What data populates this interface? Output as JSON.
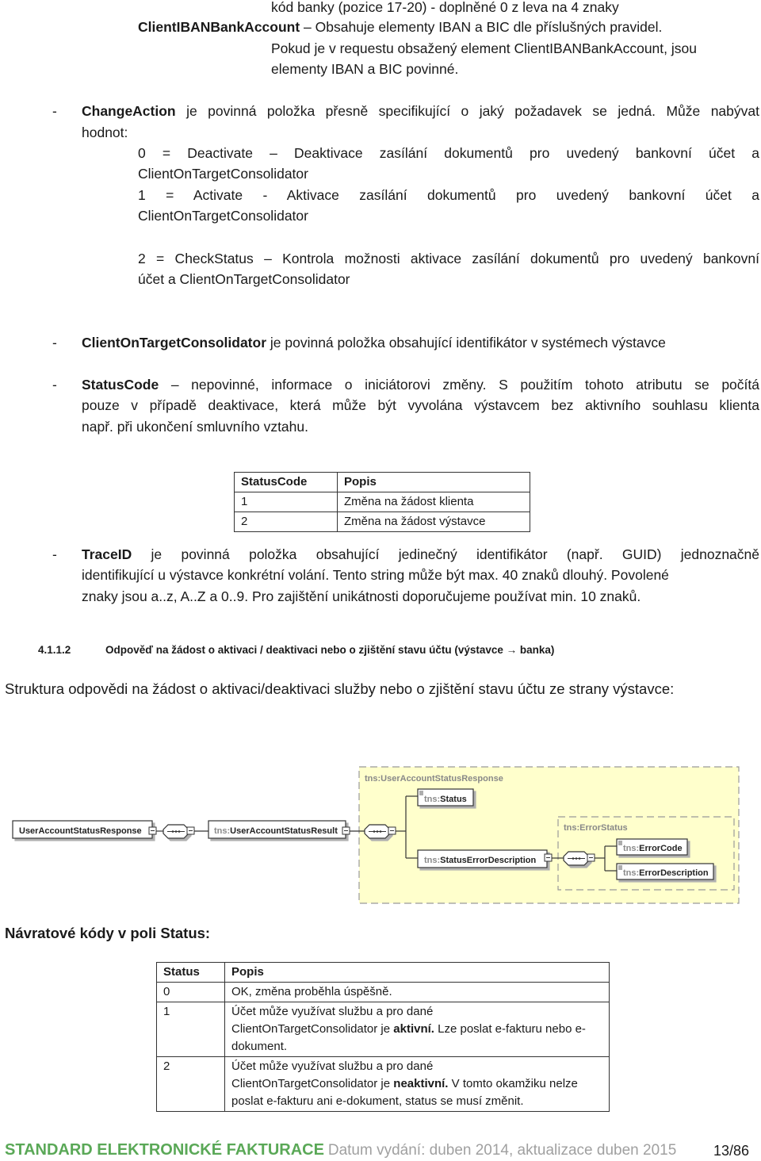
{
  "intro": {
    "bank_code_line": "kód banky (pozice 17-20) - doplněné 0 z leva na 4 znaky",
    "client_iban_term": "ClientIBANBankAccount",
    "client_iban_text": " – Obsahuje elementy IBAN a BIC dle příslušných pravidel.",
    "client_iban_note_1": "Pokud je v requestu obsažený element ClientIBANBankAccount, jsou",
    "client_iban_note_2": "elementy IBAN a BIC povinné."
  },
  "bullets": {
    "dash": "-",
    "change_action": {
      "term": "ChangeAction",
      "text": " je povinná položka přesně specifikující o jaký požadavek se jedná. Může nabývat",
      "text_2": "hodnot:",
      "values": [
        {
          "line1": "0 = Deactivate – Deaktivace zasílání dokumentů pro uvedený bankovní účet a",
          "line2": "ClientOnTargetConsolidator"
        },
        {
          "line1": "1 = Activate - Aktivace zasílání dokumentů pro uvedený bankovní účet a",
          "line2": "ClientOnTargetConsolidator"
        },
        {
          "line1": "2 = CheckStatus – Kontrola možnosti aktivace zasílání dokumentů pro uvedený bankovní",
          "line2": "účet a ClientOnTargetConsolidator"
        }
      ]
    },
    "consolidator": {
      "term": "ClientOnTargetConsolidator",
      "text": " je povinná položka obsahující identifikátor v systémech výstavce"
    },
    "status_code": {
      "term": "StatusCode",
      "text_1": " – nepovinné, informace o iniciátorovi změny. S použitím tohoto atributu se počítá",
      "text_2": "pouze v případě deaktivace, která může být vyvolána výstavcem bez aktivního souhlasu klienta",
      "text_3": "např. při ukončení smluvního vztahu."
    },
    "trace_id": {
      "term": "TraceID",
      "text_1": " je povinná položka obsahující jedinečný identifikátor (např. GUID) jednoznačně",
      "text_2": "identifikující u výstavce konkrétní volání. Tento string může být max. 40 znaků dlouhý. Povolené",
      "text_3": "znaky jsou a..z, A..Z a 0..9. Pro zajištění unikátnosti doporučujeme používat min. 10 znaků."
    }
  },
  "status_code_table": {
    "headers": [
      "StatusCode",
      "Popis"
    ],
    "rows": [
      [
        "1",
        "Změna na žádost klienta"
      ],
      [
        "2",
        "Změna na žádost výstavce"
      ]
    ]
  },
  "section": {
    "number": "4.1.1.2",
    "title": "Odpověď na žádost o aktivaci / deaktivaci nebo o zjištění stavu účtu (výstavce → banka)",
    "intro": "Struktura odpovědi na žádost o aktivaci/deaktivaci služby nebo o zjištění stavu účtu ze strany výstavce:"
  },
  "diagram": {
    "root": "UserAccountStatusResponse",
    "prefix": "tns:",
    "result": "UserAccountStatusResult",
    "group_label": "tns:UserAccountStatusResponse",
    "status": "Status",
    "status_error_description": "StatusErrorDescription",
    "error_group_label": "tns:ErrorStatus",
    "error_code": "ErrorCode",
    "error_description": "ErrorDescription",
    "colors": {
      "group_fill": "#ffffcc",
      "group_border": "#999999",
      "prefix": "#8a8a8a"
    }
  },
  "return_codes": {
    "heading": "Návratové kódy v poli Status:",
    "headers": [
      "Status",
      "Popis"
    ],
    "rows": [
      {
        "code": "0",
        "pre": "OK, změna proběhla úspěšně.",
        "line2_pre": "",
        "bold": "",
        "post": ""
      },
      {
        "code": "1",
        "pre": "Účet může využívat službu a pro dané",
        "line2_pre": "ClientOnTargetConsolidator je ",
        "bold": "aktivní.",
        "post": " Lze poslat e-fakturu nebo e-dokument."
      },
      {
        "code": "2",
        "pre": "Účet může využívat službu a pro dané",
        "line2_pre": "ClientOnTargetConsolidator je ",
        "bold": "neaktivní.",
        "post": " V tomto okamžiku nelze poslat e-fakturu ani e-dokument, status se musí změnit."
      }
    ]
  },
  "footer": {
    "title": "STANDARD ELEKTRONICKÉ FAKTURACE",
    "date": "Datum vydání: duben 2014, aktualizace duben 2015",
    "page": "13/86"
  }
}
